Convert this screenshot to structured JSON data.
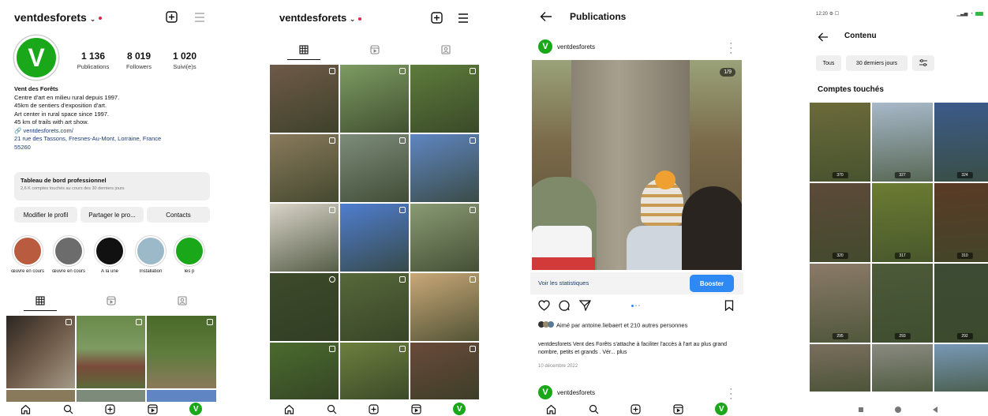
{
  "colors": {
    "accent_green": "#1aa81a",
    "boost_blue": "#2f89f5",
    "link_blue": "#1b3a78",
    "notification_red": "#e0244a"
  },
  "profile": {
    "username": "ventdesforets",
    "avatar_letter": "V",
    "stats": [
      {
        "value": "1 136",
        "label": "Publications"
      },
      {
        "value": "8 019",
        "label": "Followers"
      },
      {
        "value": "1 020",
        "label": "Suivi(e)s"
      }
    ],
    "bio": {
      "name": "Vent des Forêts",
      "lines": [
        "Centre d'art en milieu rural depuis 1997.",
        "45km de sentiers d'exposition d'art.",
        "Art center in rural space since 1997.",
        "45 km of trails with art show."
      ],
      "website": "ventdesforets.com/",
      "address_line1": "21 rue des Tassons, Fresnes-Au-Mont, Lorraine, France",
      "address_line2": "55260"
    },
    "dashboard": {
      "title": "Tableau de bord professionnel",
      "subtitle": "2,6 K comptes touchés au cours des 30 derniers jours"
    },
    "buttons": {
      "edit": "Modifier le profil",
      "share": "Partager le pro...",
      "contacts": "Contacts"
    },
    "highlights": [
      {
        "label": "œuvre en cours",
        "color": "#b85b3e"
      },
      {
        "label": "œuvre en cours",
        "color": "#6c6c6c"
      },
      {
        "label": "À la une",
        "color": "#111111"
      },
      {
        "label": "Installation",
        "color": "#9bb9c8"
      },
      {
        "label": "les p",
        "color": "#1aa81a"
      }
    ]
  },
  "publications": {
    "title": "Publications",
    "author": "ventdesforets",
    "carousel_counter": "1/9",
    "stats_link": "Voir les statistiques",
    "boost_label": "Booster",
    "liked_by": "Aimé par antoine.liebaert et 210 autres personnes",
    "caption": "ventdesforets Vent des Forêts s'attache à faciliter l'accès à l'art au plus grand nombre, petits et grands . Vér... plus",
    "date": "10 décembre 2022",
    "next_author": "ventdesforets"
  },
  "content": {
    "status_time": "12:20",
    "title": "Contenu",
    "filters": [
      "Tous",
      "30 derniers jours"
    ],
    "section_title": "Comptes touchés",
    "counts": [
      "370",
      "327",
      "324",
      "320",
      "317",
      "310",
      "295",
      "293",
      "292"
    ]
  },
  "grid_colors": [
    "#6f5a48",
    "#7d9b62",
    "#5e7c3c",
    "#8a7a5c",
    "#7d8c7a",
    "#5f86c2",
    "#d9d4c8",
    "#4f7ed0",
    "#8a9a74",
    "#3d4a2a",
    "#56683a",
    "#c9a878",
    "#4a6b2e",
    "#6c7f3e",
    "#6a4a3a"
  ],
  "content_colors": [
    "#6b6a3a",
    "#a7b8c9",
    "#3b5a8a",
    "#5c4a38",
    "#6c7c32",
    "#5a3a26",
    "#8a7a68",
    "#4c5a3a",
    "#3e4b35",
    "#7a6e5e",
    "#8a8a80",
    "#7898b6"
  ]
}
